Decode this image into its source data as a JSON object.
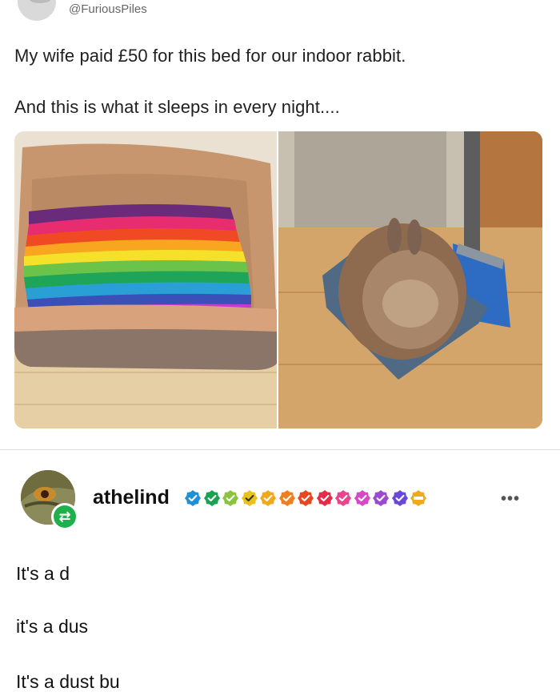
{
  "tweet": {
    "handle": "@FuriousPiles",
    "line1": "My wife paid £50 for this bed for our indoor rabbit.",
    "line2": "And this is what it sleeps in every night...."
  },
  "post": {
    "username": "athelind",
    "badge_colors": [
      "#1f8fd6",
      "#1aa152",
      "#8ac43f",
      "#e8c21a",
      "#f0a81c",
      "#f07e1c",
      "#e8461d",
      "#e52a4a",
      "#e8458c",
      "#d44ac6",
      "#9b4ad0",
      "#6a48d8",
      "#f0a81c"
    ],
    "reblog_icon": "reblog-icon",
    "more_label": "•••",
    "lines": [
      "It's a d",
      "it's a dus",
      "It's a dust bu"
    ]
  }
}
